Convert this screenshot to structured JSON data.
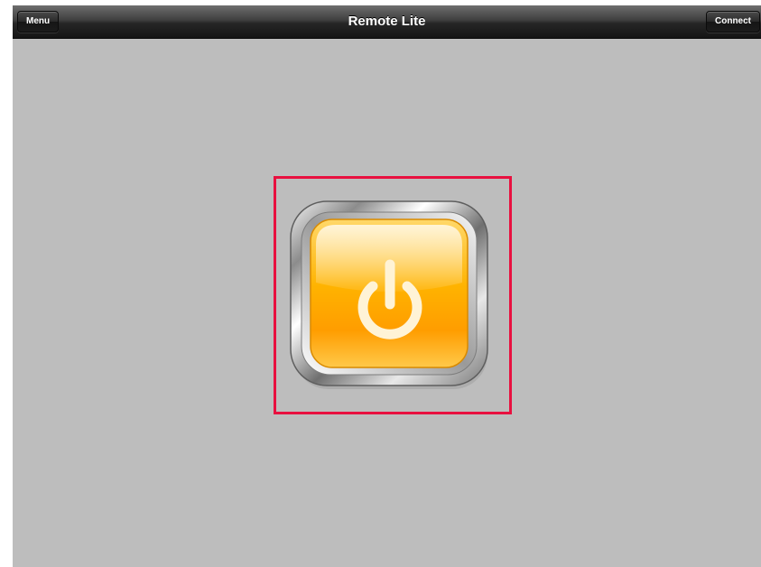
{
  "navbar": {
    "title": "Remote Lite",
    "menu_label": "Menu",
    "connect_label": "Connect"
  },
  "power_button": {
    "icon": "power-icon",
    "highlighted": true
  },
  "colors": {
    "background": "#bdbdbd",
    "navbar": "#262626",
    "highlight_border": "#e8103f",
    "button_orange": "#ffa800",
    "icon_cream": "#fff3d6"
  }
}
